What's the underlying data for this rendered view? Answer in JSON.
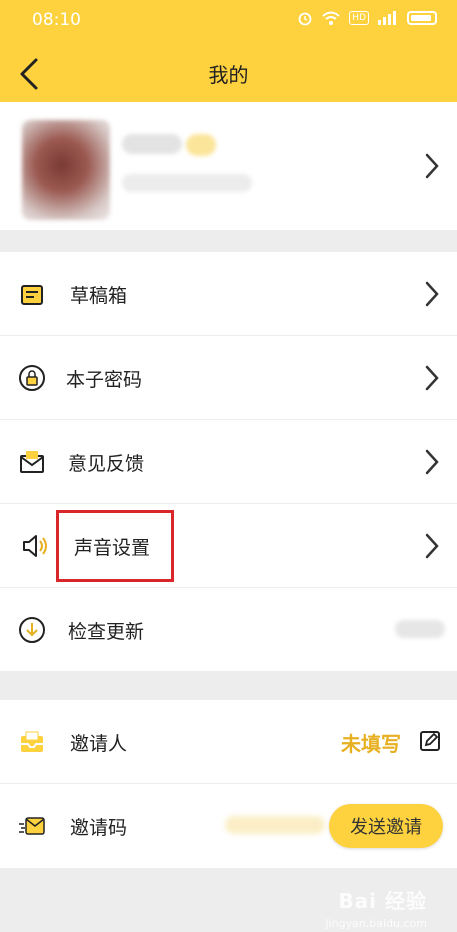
{
  "status": {
    "time": "08:10",
    "hd": "HD"
  },
  "header": {
    "title": "我的"
  },
  "menu": [
    {
      "label": "草稿箱",
      "icon": "draft-box-icon"
    },
    {
      "label": "本子密码",
      "icon": "lock-icon"
    },
    {
      "label": "意见反馈",
      "icon": "feedback-mail-icon"
    },
    {
      "label": "声音设置",
      "icon": "speaker-icon"
    },
    {
      "label": "检查更新",
      "icon": "download-icon"
    }
  ],
  "invite": {
    "inviter_label": "邀请人",
    "inviter_value": "未填写",
    "code_label": "邀请码",
    "send_button": "发送邀请"
  },
  "watermark": {
    "text": "Bai 经验",
    "sub": "jingyan.baidu.com"
  },
  "colors": {
    "accent": "#fdd23e",
    "highlight": "#d8262a",
    "value": "#e7b021"
  }
}
